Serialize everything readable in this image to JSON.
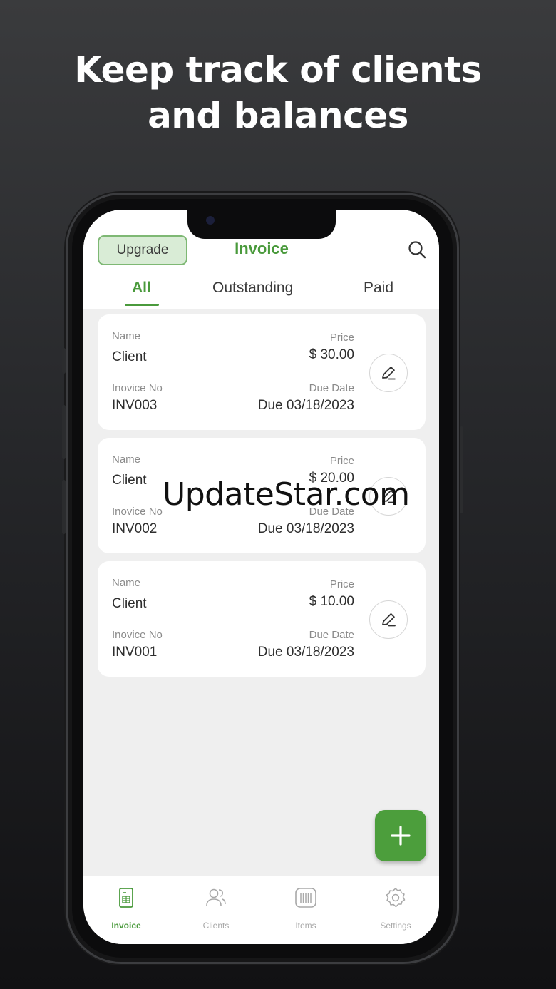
{
  "headline": {
    "line1": "Keep track of clients",
    "line2": "and balances"
  },
  "header": {
    "upgrade_label": "Upgrade",
    "title": "Invoice",
    "search_icon": "search-icon"
  },
  "tabs": [
    {
      "label": "All",
      "active": true
    },
    {
      "label": "Outstanding",
      "active": false
    },
    {
      "label": "Paid",
      "active": false
    }
  ],
  "invoices": [
    {
      "name_label": "Name",
      "name": "Client",
      "price_label": "Price",
      "price": "$ 30.00",
      "no_label": "Inovice No",
      "no": "INV003",
      "due_label": "Due Date",
      "due": "Due 03/18/2023"
    },
    {
      "name_label": "Name",
      "name": "Client",
      "price_label": "Price",
      "price": "$ 20.00",
      "no_label": "Inovice No",
      "no": "INV002",
      "due_label": "Due Date",
      "due": "Due 03/18/2023"
    },
    {
      "name_label": "Name",
      "name": "Client",
      "price_label": "Price",
      "price": "$ 10.00",
      "no_label": "Inovice No",
      "no": "INV001",
      "due_label": "Due Date",
      "due": "Due 03/18/2023"
    }
  ],
  "fab": {
    "icon": "plus-icon"
  },
  "nav": [
    {
      "label": "Invoice",
      "icon": "invoice-icon",
      "active": true
    },
    {
      "label": "Clients",
      "icon": "clients-icon",
      "active": false
    },
    {
      "label": "Items",
      "icon": "barcode-icon",
      "active": false
    },
    {
      "label": "Settings",
      "icon": "gear-icon",
      "active": false
    }
  ],
  "watermark": "UpdateStar.com",
  "colors": {
    "accent": "#4a9a3c",
    "upgrade_bg": "#d9ecd6",
    "card_bg": "#ffffff",
    "screen_bg": "#efefef"
  }
}
